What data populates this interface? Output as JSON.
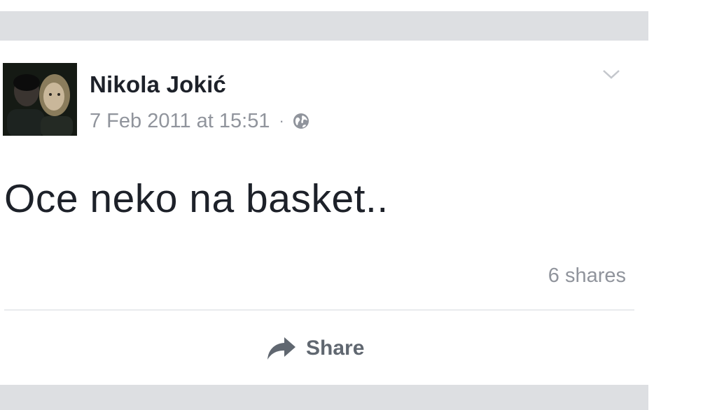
{
  "post": {
    "author": "Nikola Jokić",
    "timestamp": "7 Feb 2011 at 15:51",
    "separator": "·",
    "privacy_icon": "globe-icon",
    "menu_icon": "chevron-down-icon",
    "text": "Oce neko na basket..",
    "shares": "6 shares",
    "actions": {
      "share_label": "Share",
      "share_icon": "share-arrow-icon"
    }
  },
  "colors": {
    "feed_background": "#dddfe2",
    "card_background": "#ffffff",
    "primary_text": "#1d2129",
    "secondary_text": "#90949c",
    "action_text": "#606770"
  }
}
